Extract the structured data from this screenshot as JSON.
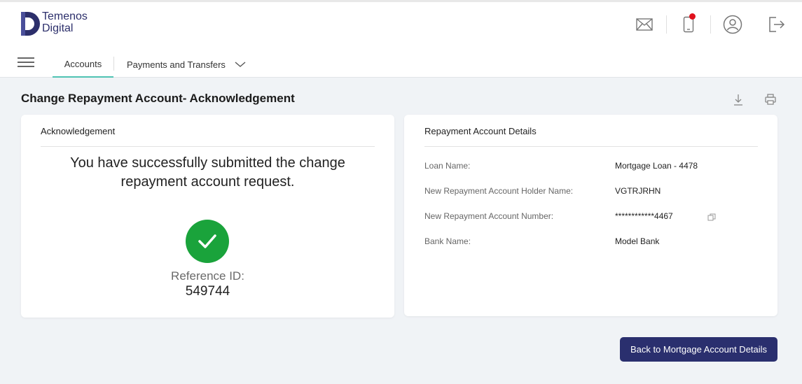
{
  "brand": {
    "line1": "Temenos",
    "line2": "Digital"
  },
  "header": {
    "icons": [
      "mail-icon",
      "mobile-icon",
      "profile-icon",
      "logout-icon"
    ],
    "notification_color": "#e0101c"
  },
  "nav": {
    "tabs": [
      {
        "label": "Accounts",
        "active": true
      },
      {
        "label": "Payments and Transfers",
        "active": false
      }
    ]
  },
  "page": {
    "title": "Change Repayment Account- Acknowledgement"
  },
  "acknowledgement": {
    "heading": "Acknowledgement",
    "message": "You have successfully submitted the change repayment account request.",
    "reference_label": "Reference ID:",
    "reference_id": "549744"
  },
  "details": {
    "heading": "Repayment Account Details",
    "rows": [
      {
        "label": "Loan Name:",
        "value": "Mortgage Loan - 4478"
      },
      {
        "label": "New Repayment Account Holder Name:",
        "value": "VGTRJRHN"
      },
      {
        "label": "New Repayment Account Number:",
        "value": "************4467"
      },
      {
        "label": "Bank Name:",
        "value": "Model Bank"
      }
    ]
  },
  "actions": {
    "back_label": "Back to Mortgage Account Details"
  },
  "colors": {
    "accent": "#4fc3b3",
    "primary": "#2a2f6e",
    "success": "#1aa33b"
  }
}
